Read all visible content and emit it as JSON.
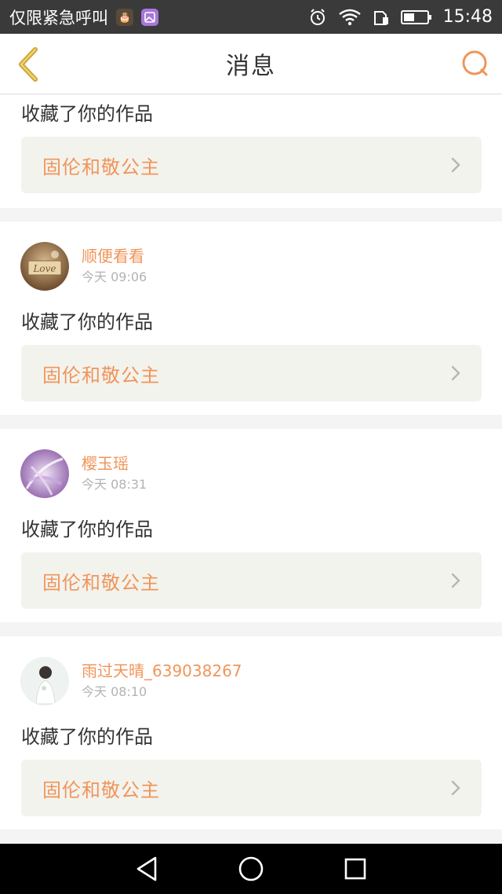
{
  "status_bar": {
    "carrier_text": "仅限紧急呼叫",
    "time": "15:48",
    "icons": [
      "app-cake-icon",
      "gallery-app-icon",
      "alarm-icon",
      "wifi-icon",
      "sim-icon",
      "battery-icon"
    ]
  },
  "header": {
    "title": "消息",
    "back_icon": "chevron-left-icon",
    "search_icon": "search-icon"
  },
  "colors": {
    "accent": "#f0955a",
    "back_arrow": "#c9a23a",
    "text": "#333333",
    "muted": "#b3b3b3",
    "card_bg": "#ffffff",
    "link_bg": "#f3f3ee",
    "page_bg": "#f4f4f4"
  },
  "messages": [
    {
      "user": "",
      "time": "",
      "action": "收藏了你的作品",
      "work": "固伦和敬公主"
    },
    {
      "user": "顺便看看",
      "time": "今天 09:06",
      "action": "收藏了你的作品",
      "work": "固伦和敬公主"
    },
    {
      "user": "樱玉瑶",
      "time": "今天 08:31",
      "action": "收藏了你的作品",
      "work": "固伦和敬公主"
    },
    {
      "user": "雨过天晴_639038267",
      "time": "今天 08:10",
      "action": "收藏了你的作品",
      "work": "固伦和敬公主"
    }
  ],
  "nav_bar": {
    "back_icon": "nav-back-icon",
    "home_icon": "nav-home-icon",
    "recents_icon": "nav-recents-icon"
  }
}
